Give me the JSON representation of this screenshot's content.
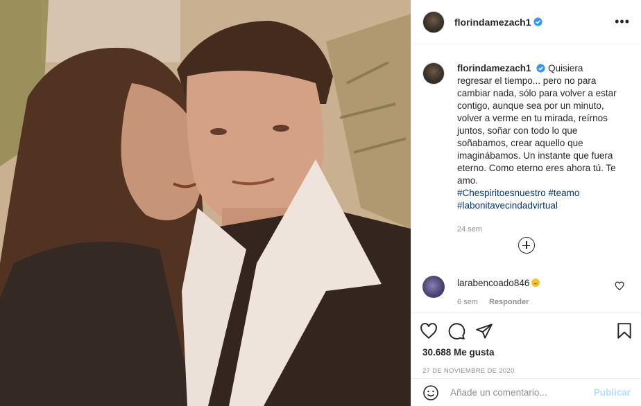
{
  "post": {
    "username": "florindamezach1",
    "verified": true,
    "more_label": "•••",
    "caption_text": "Quisiera regresar el tiempo... pero no para cambiar nada, sólo para volver a estar contigo, aunque sea por un minuto, volver a verme en tu mirada, reírnos juntos, soñar con todo lo que soñabamos, crear aquello que imaginábamos. Un instante que fuera eterno. Como eterno eres ahora tú. Te amo.",
    "hashtags": [
      "#Chespiritoesnuestro",
      "#teamo",
      "#labonitavecindadvirtual"
    ],
    "caption_time": "24 sem",
    "likes": "30.688 Me gusta",
    "date": "27 DE NOVIEMBRE DE 2020"
  },
  "comment": {
    "username": "larabencoado846",
    "time": "6 sem",
    "reply_label": "Responder"
  },
  "composer": {
    "placeholder": "Añade un comentario...",
    "publish_label": "Publicar"
  },
  "icons": {
    "more": "more-options-icon",
    "load_more": "plus-circle-icon",
    "like": "heart-icon",
    "comment": "comment-icon",
    "share": "paper-plane-icon",
    "save": "bookmark-icon",
    "emoji": "smiley-icon"
  },
  "colors": {
    "verified": "#3897f0",
    "link": "#00376b",
    "muted": "#8e8e8e",
    "publish_disabled": "#b2dffc"
  }
}
